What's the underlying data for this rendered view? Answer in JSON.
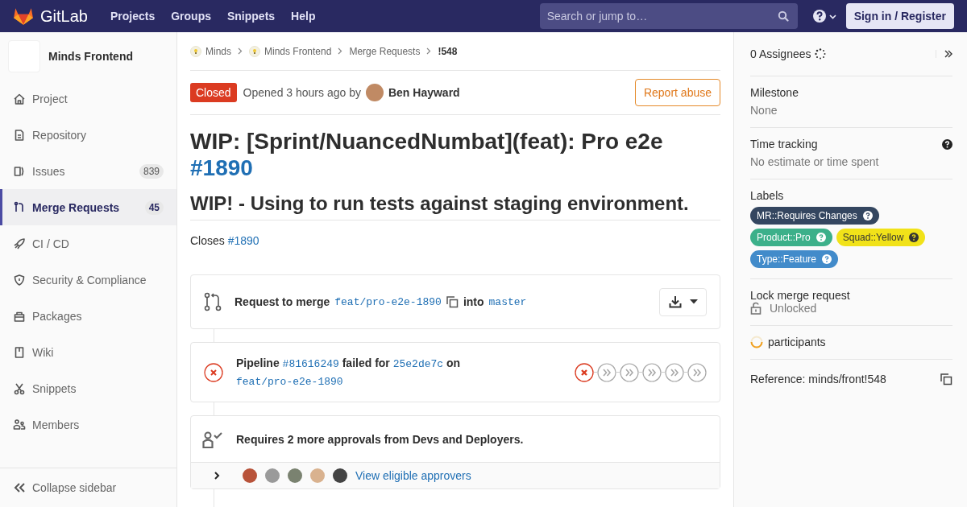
{
  "header": {
    "logo_text": "GitLab",
    "nav": [
      "Projects",
      "Groups",
      "Snippets",
      "Help"
    ],
    "search": {
      "placeholder": "Search or jump to…"
    },
    "sign_in": "Sign in / Register"
  },
  "sidebar": {
    "project_name": "Minds Frontend",
    "items": [
      {
        "label": "Project",
        "selected": false
      },
      {
        "label": "Repository",
        "selected": false
      },
      {
        "label": "Issues",
        "count": "839",
        "selected": false
      },
      {
        "label": "Merge Requests",
        "count": "45",
        "selected": true
      },
      {
        "label": "CI / CD",
        "selected": false
      },
      {
        "label": "Security & Compliance",
        "selected": false
      },
      {
        "label": "Packages",
        "selected": false
      },
      {
        "label": "Wiki",
        "selected": false
      },
      {
        "label": "Snippets",
        "selected": false
      },
      {
        "label": "Members",
        "selected": false
      }
    ],
    "collapse": "Collapse sidebar"
  },
  "breadcrumbs": [
    {
      "label": "Minds",
      "kind": "group"
    },
    {
      "label": "Minds Frontend",
      "kind": "group"
    },
    {
      "label": "Merge Requests",
      "kind": "link"
    },
    {
      "label": "!548",
      "kind": "current"
    }
  ],
  "status": {
    "badge": "Closed",
    "opened": "Opened 3 hours ago by",
    "author": "Ben Hayward",
    "report": "Report abuse"
  },
  "title": {
    "text": "WIP: [Sprint/NuancedNumbat](feat): Pro e2e",
    "link": "#1890"
  },
  "description_heading": "WIP! - Using to run tests against staging environment.",
  "closes": {
    "text": "Closes",
    "link": "#1890"
  },
  "merge_widget": {
    "prefix": "Request to merge",
    "source": "feat/pro-e2e-1890",
    "into": "into",
    "target": "master"
  },
  "pipeline": {
    "prefix": "Pipeline",
    "id": "#81616249",
    "failed_for": "failed for",
    "commit": "25e2de7c",
    "on": "on",
    "branch": "feat/pro-e2e-1890",
    "stages": [
      {
        "kind": "failed"
      },
      {
        "kind": "skipped"
      },
      {
        "kind": "skipped"
      },
      {
        "kind": "skipped"
      },
      {
        "kind": "skipped"
      },
      {
        "kind": "skipped"
      }
    ]
  },
  "approvals": {
    "text": "Requires 2 more approvals from Devs and Deployers.",
    "link": "View eligible approvers"
  },
  "right_sidebar": {
    "assignees": "0 Assignees",
    "milestone": {
      "title": "Milestone",
      "value": "None"
    },
    "time_tracking": {
      "title": "Time tracking",
      "value": "No estimate or time spent"
    },
    "labels": {
      "title": "Labels",
      "items": [
        {
          "text": "MR::Requires Changes",
          "color": "#344660"
        },
        {
          "text": "Product::Pro",
          "color": "#3cb08a"
        },
        {
          "text": "Squad::Yellow",
          "color": "#f1e219"
        },
        {
          "text": "Type::Feature",
          "color": "#428bca"
        }
      ]
    },
    "lock": {
      "title": "Lock merge request",
      "value": "Unlocked"
    },
    "participants": "participants",
    "reference": "Reference: minds/front!548"
  }
}
